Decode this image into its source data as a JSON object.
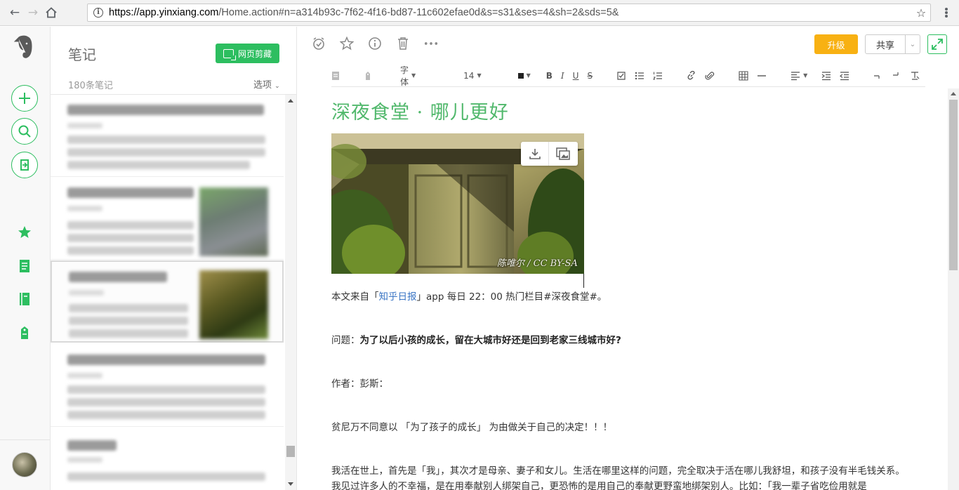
{
  "browser": {
    "url_scheme_host": "https://app.yinxiang.com",
    "url_rest": "/Home.action#n=a314b93c-7f62-4f16-bd87-11c602efae0d&s=s31&ses=4&sh=2&sds=5&"
  },
  "rail": {
    "icons": [
      "evernote-logo-icon",
      "new-note-icon",
      "search-icon",
      "work-chat-icon",
      "shortcuts-star-icon",
      "notes-icon",
      "notebooks-icon",
      "tags-icon"
    ]
  },
  "list": {
    "title": "笔记",
    "clip_button": "网页剪藏",
    "count": "180条笔记",
    "options": "选项"
  },
  "editor": {
    "upgrade": "升级",
    "share": "共享",
    "toolbar": {
      "font": "字体",
      "size": "14"
    },
    "title": "深夜食堂 · 哪儿更好",
    "image_caption": "陈唯尔 / CC BY-SA",
    "p1_prefix": "本文来自「",
    "p1_link": "知乎日报",
    "p1_suffix": "」app 每日 22：00 热门栏目#深夜食堂#。",
    "p2_label": "问题：",
    "p2_question": "为了以后小孩的成长，留在大城市好还是回到老家三线城市好?",
    "p3": "作者：彭斯：",
    "p4": "贫尼万不同意以 「为了孩子的成长」 为由做关于自己的决定！！！",
    "p5": "我活在世上，首先是「我」，其次才是母亲、妻子和女儿。生活在哪里这样的问题，完全取决于活在哪儿我舒坦，和孩子没有半毛钱关系。我见过许多人的不幸福，是在用奉献别人绑架自己，更恐怖的是用自己的奉献更野蛮地绑架别人。比如：「我一辈子省吃俭用就是"
  },
  "colors": {
    "brand_green": "#2dbe60",
    "upgrade_orange": "#f8b113",
    "title_green": "#51b86c",
    "link_blue": "#3a75c4"
  }
}
